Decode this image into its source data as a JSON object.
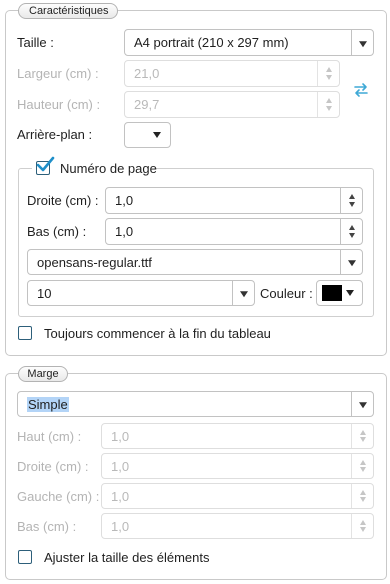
{
  "caracteristiques": {
    "legend": "Caractéristiques",
    "taille": {
      "label": "Taille :",
      "value": "A4 portrait (210 x 297 mm)"
    },
    "largeur": {
      "label": "Largeur (cm) :",
      "value": "21,0"
    },
    "hauteur": {
      "label": "Hauteur (cm) :",
      "value": "29,7"
    },
    "arriere_plan": {
      "label": "Arrière-plan :",
      "color": "#ffffff"
    },
    "numero": {
      "label": "Numéro de page",
      "checked": true,
      "droite": {
        "label": "Droite (cm) :",
        "value": "1,0"
      },
      "bas": {
        "label": "Bas (cm) :",
        "value": "1,0"
      },
      "font": "opensans-regular.ttf",
      "size": "10",
      "couleur_label": "Couleur :",
      "couleur": "#000000"
    },
    "toujours": {
      "label": "Toujours commencer à la fin du tableau",
      "checked": false
    }
  },
  "marge": {
    "legend": "Marge",
    "mode": "Simple",
    "haut": {
      "label": "Haut (cm) :",
      "value": "1,0"
    },
    "droite": {
      "label": "Droite (cm) :",
      "value": "1,0"
    },
    "gauche": {
      "label": "Gauche (cm) :",
      "value": "1,0"
    },
    "bas": {
      "label": "Bas (cm) :",
      "value": "1,0"
    },
    "ajuster": {
      "label": "Ajuster la taille des éléments",
      "checked": false
    }
  }
}
